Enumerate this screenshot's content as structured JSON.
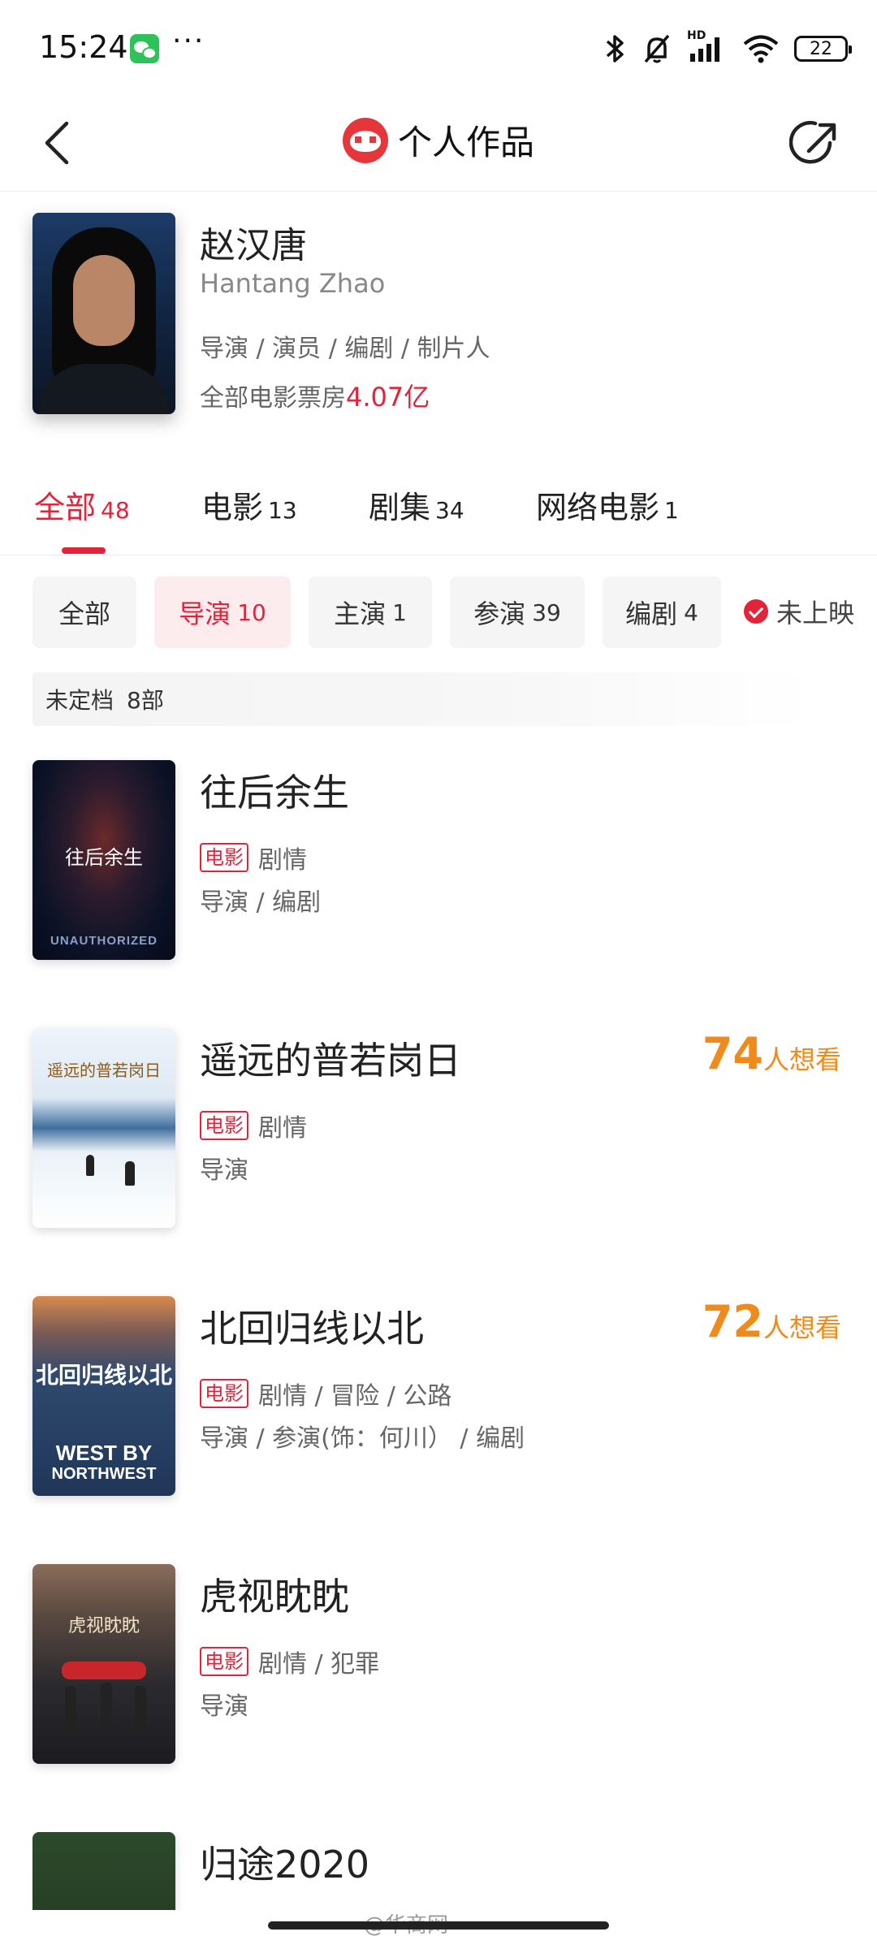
{
  "status_bar": {
    "time": "15:24",
    "more": "···",
    "battery": "22",
    "network_label": "HD"
  },
  "header": {
    "title": "个人作品"
  },
  "profile": {
    "name_cn": "赵汉唐",
    "name_en": "Hantang Zhao",
    "roles": "导演 / 演员 / 编剧 / 制片人",
    "box_office_label": "全部电影票房",
    "box_office_value": "4.07亿"
  },
  "tabs": [
    {
      "label": "全部",
      "count": "48",
      "active": true
    },
    {
      "label": "电影",
      "count": "13"
    },
    {
      "label": "剧集",
      "count": "34"
    },
    {
      "label": "网络电影",
      "count": "1"
    }
  ],
  "filters": [
    {
      "label": "全部",
      "count": ""
    },
    {
      "label": "导演",
      "count": "10",
      "active": true
    },
    {
      "label": "主演",
      "count": "1"
    },
    {
      "label": "参演",
      "count": "39"
    },
    {
      "label": "编剧",
      "count": "4"
    }
  ],
  "unreleased_label": "未上映",
  "section": {
    "label": "未定档",
    "count": "8部"
  },
  "movies": [
    {
      "title": "往后余生",
      "tag": "电影",
      "genres": "剧情",
      "roles": "导演 / 编剧",
      "poster_text": "往后余生",
      "poster_band": "UNAUTHORIZED"
    },
    {
      "title": "遥远的普若岗日",
      "tag": "电影",
      "genres": "剧情",
      "roles": "导演",
      "want_count": "74",
      "want_label": "人想看",
      "poster_text": "遥远的普若岗日"
    },
    {
      "title": "北回归线以北",
      "tag": "电影",
      "genres": "剧情 / 冒险 / 公路",
      "roles": "导演 / 参演(饰：何川） / 编剧",
      "want_count": "72",
      "want_label": "人想看",
      "poster_text": "北回归线以北",
      "poster_band_1": "WEST BY",
      "poster_band_2": "NORTHWEST"
    },
    {
      "title": "虎视眈眈",
      "tag": "电影",
      "genres": "剧情 / 犯罪",
      "roles": "导演",
      "poster_text": "虎视眈眈"
    },
    {
      "title": "归途2020"
    }
  ],
  "watermark": "@华商网"
}
